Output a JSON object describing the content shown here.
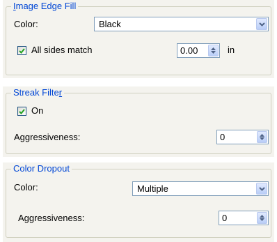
{
  "image_edge_fill": {
    "title_accel": "I",
    "title_rest": "mage Edge Fill",
    "color_label": "Color:",
    "color_value": "Black",
    "all_sides_label": "All sides match",
    "all_sides_checked": true,
    "amount_value": "0.00",
    "unit": "in"
  },
  "streak_filter": {
    "title_pre": "Streak Filte",
    "title_accel": "r",
    "on_label": "On",
    "on_checked": true,
    "aggressiveness_label": "Aggressiveness:",
    "aggressiveness_value": "0"
  },
  "color_dropout": {
    "title": "Color Dropout",
    "color_label": "Color:",
    "color_value": "Multiple",
    "aggressiveness_label": "Aggressiveness:",
    "aggressiveness_value": "0"
  },
  "colors": {
    "legend_text": "#0046d5",
    "field_border": "#7f9db9",
    "check_mark": "#21a121",
    "panel_bg": "#f4f3ee"
  }
}
